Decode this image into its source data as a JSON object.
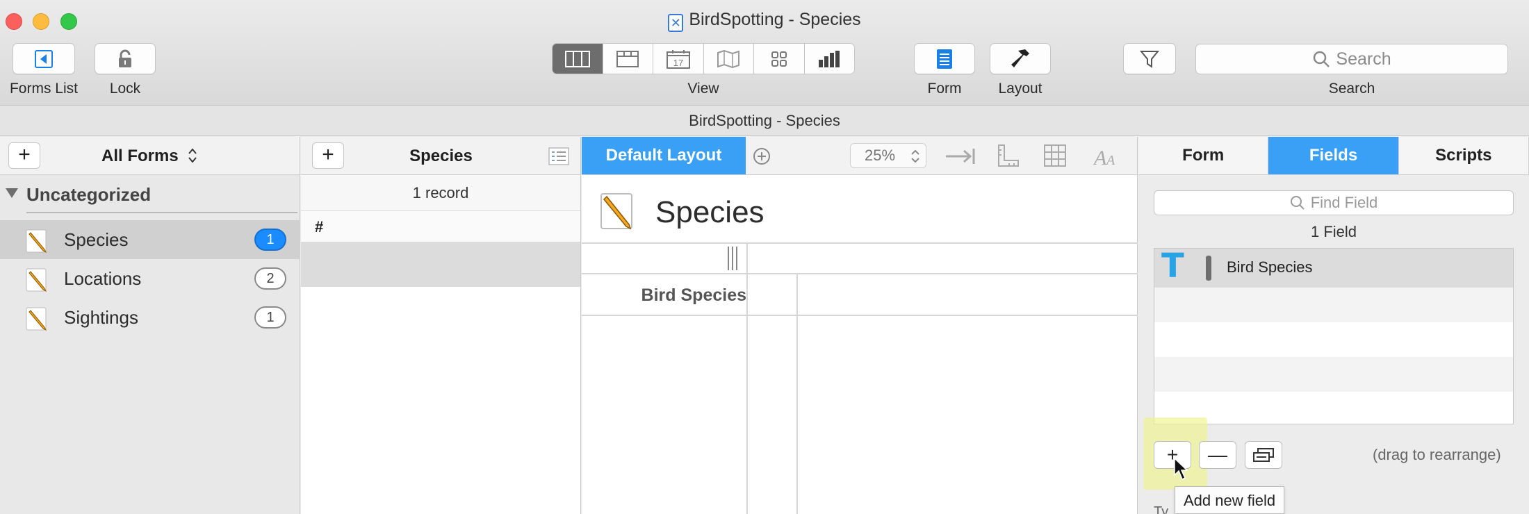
{
  "window": {
    "title": "BirdSpotting - Species",
    "subtitle": "BirdSpotting - Species"
  },
  "toolbar": {
    "forms_list_label": "Forms List",
    "lock_label": "Lock",
    "view_label": "View",
    "form_label": "Form",
    "layout_label": "Layout",
    "search_placeholder": "Search",
    "search_label": "Search",
    "view_modes": [
      "columns-view-icon",
      "cards-view-icon",
      "calendar-view-icon",
      "map-view-icon",
      "grid-view-icon",
      "chart-view-icon"
    ],
    "calendar_day": "17",
    "active_view": "columns-view-icon",
    "accent": "#3aa0f5"
  },
  "sidebar": {
    "all_forms_label": "All Forms",
    "group_label": "Uncategorized",
    "items": [
      {
        "label": "Species",
        "count": "1",
        "selected": true
      },
      {
        "label": "Locations",
        "count": "2",
        "selected": false
      },
      {
        "label": "Sightings",
        "count": "1",
        "selected": false
      }
    ]
  },
  "records": {
    "title": "Species",
    "count_label": "1 record",
    "column_header": "#"
  },
  "editor": {
    "layout_button": "Default Layout",
    "zoom": "25%",
    "form_title": "Species",
    "field_label": "Bird Species"
  },
  "inspector": {
    "tabs": [
      {
        "label": "Form",
        "active": false
      },
      {
        "label": "Fields",
        "active": true
      },
      {
        "label": "Scripts",
        "active": false
      }
    ],
    "find_placeholder": "Find Field",
    "field_count": "1 Field",
    "field_type_glyph": "T",
    "fields": [
      {
        "name": "Bird Species",
        "type": "text"
      }
    ],
    "add_glyph": "+",
    "remove_glyph": "—",
    "drag_hint": "(drag to rearrange)",
    "tooltip": "Add new field",
    "below_label": "Ty"
  }
}
